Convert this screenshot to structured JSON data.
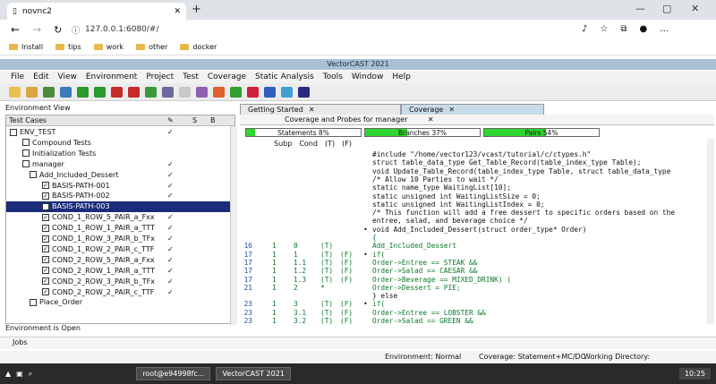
{
  "browser": {
    "tab_title": "novnc2",
    "url": "127.0.0.1:6080/#/",
    "bookmarks": [
      "Install",
      "tips",
      "work",
      "other",
      "docker"
    ]
  },
  "app": {
    "title": "VectorCAST 2021",
    "menu": [
      "File",
      "Edit",
      "View",
      "Environment",
      "Project",
      "Test",
      "Coverage",
      "Static Analysis",
      "Tools",
      "Window",
      "Help"
    ]
  },
  "left": {
    "env_view_label": "Environment View",
    "header": {
      "test_cases": "Test Cases",
      "s": "S",
      "b": "B"
    },
    "rows": [
      {
        "label": "ENV_TEST",
        "mark": "✓"
      },
      {
        "label": "Compound Tests",
        "mark": ""
      },
      {
        "label": "Initialization Tests",
        "mark": ""
      },
      {
        "label": "manager",
        "mark": "✓"
      },
      {
        "label": "Add_Included_Dessert",
        "mark": "✓"
      },
      {
        "label": "BASIS-PATH-001",
        "mark": "✓"
      },
      {
        "label": "BASIS-PATH-002",
        "mark": "✓"
      },
      {
        "label": "BASIS-PATH-003",
        "mark": ""
      },
      {
        "label": "COND_1_ROW_5_PAIR_a_Fxx",
        "mark": "✓"
      },
      {
        "label": "COND_1_ROW_1_PAIR_a_TTT",
        "mark": "✓"
      },
      {
        "label": "COND_1_ROW_3_PAIR_b_TFx",
        "mark": "✓"
      },
      {
        "label": "COND_1_ROW_2_PAIR_c_TTF",
        "mark": "✓"
      },
      {
        "label": "COND_2_ROW_5_PAIR_a_Fxx",
        "mark": "✓"
      },
      {
        "label": "COND_2_ROW_1_PAIR_a_TTT",
        "mark": "✓"
      },
      {
        "label": "COND_2_ROW_3_PAIR_b_TFx",
        "mark": "✓"
      },
      {
        "label": "COND_2_ROW_2_PAIR_c_TTF",
        "mark": "✓"
      },
      {
        "label": "Place_Order",
        "mark": ""
      }
    ],
    "status": "Environment is Open"
  },
  "right": {
    "tabs": [
      "Getting Started",
      "Coverage"
    ],
    "subtab": "Coverage and Probes for manager",
    "metrics": [
      {
        "label": "Statements 8%",
        "fill": 0.08
      },
      {
        "label": "Branches 37%",
        "fill": 0.37
      },
      {
        "label": "Pairs 54%",
        "fill": 0.54
      }
    ],
    "code_header": [
      "Subp",
      "Cond",
      "(T)",
      "(F)"
    ],
    "lines": [
      {
        "ln": "",
        "sp": "",
        "cnd": "",
        "t": "",
        "f": "",
        "dot": "",
        "src": "#include \"/home/vector123/vcast/tutorial/c/ctypes.h\"",
        "cov": false
      },
      {
        "ln": "",
        "sp": "",
        "cnd": "",
        "t": "",
        "f": "",
        "dot": "",
        "src": "struct table_data_type Get_Table_Record(table_index_type Table);",
        "cov": false
      },
      {
        "ln": "",
        "sp": "",
        "cnd": "",
        "t": "",
        "f": "",
        "dot": "",
        "src": "void Update_Table_Record(table_index_type Table, struct table_data_type",
        "cov": false
      },
      {
        "ln": "",
        "sp": "",
        "cnd": "",
        "t": "",
        "f": "",
        "dot": "",
        "src": "/* Allow 10 Parties to wait */",
        "cov": false
      },
      {
        "ln": "",
        "sp": "",
        "cnd": "",
        "t": "",
        "f": "",
        "dot": "",
        "src": "static name_type WaitingList[10];",
        "cov": false
      },
      {
        "ln": "",
        "sp": "",
        "cnd": "",
        "t": "",
        "f": "",
        "dot": "",
        "src": "static unsigned int WaitingListSize = 0;",
        "cov": false
      },
      {
        "ln": "",
        "sp": "",
        "cnd": "",
        "t": "",
        "f": "",
        "dot": "",
        "src": "static unsigned int WaitingListIndex = 0;",
        "cov": false
      },
      {
        "ln": "",
        "sp": "",
        "cnd": "",
        "t": "",
        "f": "",
        "dot": "",
        "src": "/* This function will add a free dessert to specific orders based on the",
        "cov": false
      },
      {
        "ln": "",
        "sp": "",
        "cnd": "",
        "t": "",
        "f": "",
        "dot": "",
        "src": "   entree, salad, and beverage choice */",
        "cov": false
      },
      {
        "ln": "",
        "sp": "",
        "cnd": "",
        "t": "",
        "f": "",
        "dot": "•",
        "src": "void Add_Included_Dessert(struct order_type* Order)",
        "cov": false
      },
      {
        "ln": "",
        "sp": "",
        "cnd": "",
        "t": "",
        "f": "",
        "dot": "",
        "src": "{",
        "cov": true
      },
      {
        "ln": "16",
        "sp": "1",
        "cnd": "0",
        "t": "(T)",
        "f": "",
        "dot": "",
        "src": "Add_Included_Dessert",
        "cov": true
      },
      {
        "ln": "17",
        "sp": "1",
        "cnd": "1",
        "t": "(T)",
        "f": "(F)",
        "dot": "•",
        "src": "  if(",
        "cov": true
      },
      {
        "ln": "17",
        "sp": "1",
        "cnd": "1.1",
        "t": "(T)",
        "f": "(F)",
        "dot": "",
        "src": "  Order->Entree == STEAK &&",
        "cov": true
      },
      {
        "ln": "17",
        "sp": "1",
        "cnd": "1.2",
        "t": "(T)",
        "f": "(F)",
        "dot": "",
        "src": "  Order->Salad == CAESAR &&",
        "cov": true
      },
      {
        "ln": "17",
        "sp": "1",
        "cnd": "1.3",
        "t": "(T)",
        "f": "(F)",
        "dot": "",
        "src": "  Order->Beverage == MIXED_DRINK) (",
        "cov": true
      },
      {
        "ln": "21",
        "sp": "1",
        "cnd": "2",
        "t": "*",
        "f": "",
        "dot": "",
        "src": "    Order->Dessert = PIE;",
        "cov": true
      },
      {
        "ln": "",
        "sp": "",
        "cnd": "",
        "t": "",
        "f": "",
        "dot": "",
        "src": "  } else",
        "cov": false
      },
      {
        "ln": "23",
        "sp": "1",
        "cnd": "3",
        "t": "(T)",
        "f": "(F)",
        "dot": "•",
        "src": "   if(",
        "cov": true
      },
      {
        "ln": "23",
        "sp": "1",
        "cnd": "3.1",
        "t": "(T)",
        "f": "(F)",
        "dot": "",
        "src": "   Order->Entree == LOBSTER &&",
        "cov": true
      },
      {
        "ln": "23",
        "sp": "1",
        "cnd": "3.2",
        "t": "(T)",
        "f": "(F)",
        "dot": "",
        "src": "   Order->Salad == GREEN &&",
        "cov": true
      }
    ]
  },
  "status": {
    "environment": "Environment: Normal",
    "coverage": "Coverage: Statement+MC/DC",
    "workdir": "Working Directory: /root/Desktop/Test"
  },
  "jobs_label": "Jobs",
  "taskbar": {
    "terminal": "root@e94998fc...",
    "vectorcast": "VectorCAST 2021",
    "clock": "10:25"
  }
}
